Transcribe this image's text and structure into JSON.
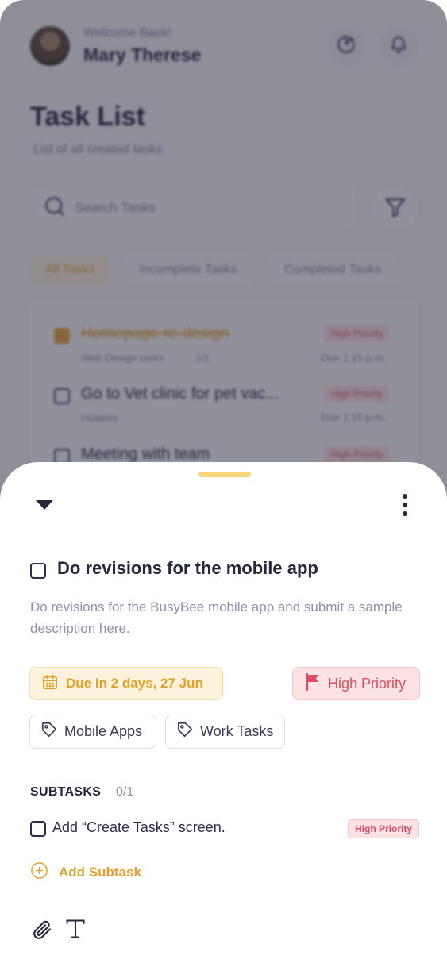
{
  "header": {
    "welcome": "Welcome Back!",
    "user_name": "Mary Therese"
  },
  "task_list": {
    "title": "Task List",
    "subtitle": "List of all created tasks",
    "search_placeholder": "Search Tasks",
    "tabs": [
      {
        "label": "All Tasks",
        "active": true
      },
      {
        "label": "Incomplete Tasks",
        "active": false
      },
      {
        "label": "Completed Tasks",
        "active": false
      }
    ],
    "tasks": [
      {
        "title": "Homepage re-design",
        "category": "Web Design tasks",
        "subtask_count": "1/1",
        "priority": "High Priority",
        "due": "Due 1:15 p.m.",
        "done": true
      },
      {
        "title": "Go to Vet clinic for pet vac...",
        "category": "Hobbies",
        "subtask_count": "",
        "priority": "High Priority",
        "due": "Due 1:15 p.m.",
        "done": false
      },
      {
        "title": "Meeting with team",
        "category": "",
        "subtask_count": "",
        "priority": "High Priority",
        "due": "",
        "done": false
      }
    ]
  },
  "sheet": {
    "task_title": "Do revisions for the mobile app",
    "description": "Do revisions for the BusyBee mobile app and submit a sample description here.",
    "due": "Due in 2 days, 27 Jun",
    "priority": "High Priority",
    "tags": [
      "Mobile Apps",
      "Work Tasks"
    ],
    "subtasks_label": "SUBTASKS",
    "subtasks_count": "0/1",
    "subtasks": [
      {
        "title": "Add “Create Tasks” screen.",
        "priority": "High Priority"
      }
    ],
    "add_subtask_label": "Add Subtask"
  },
  "colors": {
    "accent": "#e4a028",
    "priority": "#dd4e64",
    "text_dark": "#25273d",
    "text_muted": "#8e90ad"
  }
}
